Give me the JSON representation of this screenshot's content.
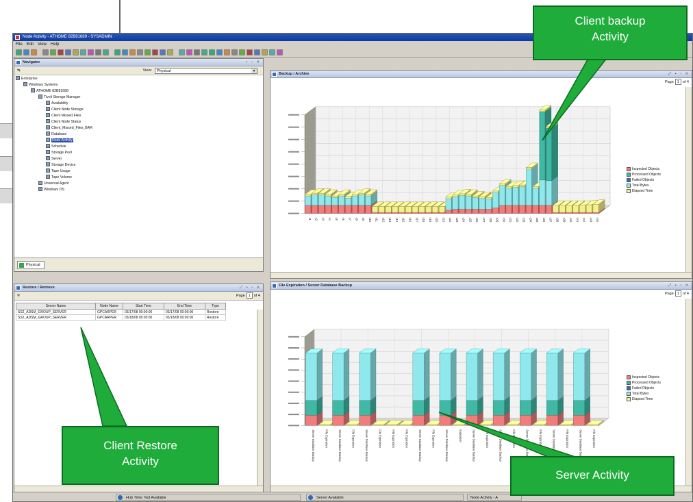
{
  "window": {
    "title": "Node Activity - ATHOME 82B81689 - SYSADMIN",
    "menus": [
      "File",
      "Edit",
      "View",
      "Help"
    ]
  },
  "navigator": {
    "title": "Navigator",
    "view_label": "View:",
    "view_value": "Physical",
    "tree": [
      {
        "label": "Enterprise",
        "level": 0
      },
      {
        "label": "Windows Systems",
        "level": 1
      },
      {
        "label": "ATHOME 82B81689",
        "level": 2
      },
      {
        "label": "Tivoli Storage Manager",
        "level": 3
      },
      {
        "label": "Availability",
        "level": 4
      },
      {
        "label": "Client Node Storage",
        "level": 4
      },
      {
        "label": "Client Missed Files",
        "level": 4
      },
      {
        "label": "Client Node Status",
        "level": 4
      },
      {
        "label": "Client_Missed_Files_BAR",
        "level": 4
      },
      {
        "label": "Database",
        "level": 4
      },
      {
        "label": "Node Activity",
        "level": 4,
        "selected": true
      },
      {
        "label": "Schedule",
        "level": 4
      },
      {
        "label": "Storage Pool",
        "level": 4
      },
      {
        "label": "Server",
        "level": 4
      },
      {
        "label": "Storage Device",
        "level": 4
      },
      {
        "label": "Tape Usage",
        "level": 4
      },
      {
        "label": "Tape Volume",
        "level": 4
      },
      {
        "label": "Universal Agent",
        "level": 3
      },
      {
        "label": "Windows OS",
        "level": 3
      }
    ],
    "tab_label": "Physical"
  },
  "restore": {
    "title": "Restore / Retrieve",
    "page_label": "Page",
    "page_value": "1",
    "page_total": "of 4",
    "columns": [
      "Server Name",
      "Node Name",
      "Start Time",
      "End Time",
      "Type"
    ],
    "rows": [
      [
        "SS2_ADSM_GROUP_SERVER",
        "GPCARPER",
        "03/17/08 00:00:00",
        "03/17/08 00:00:00",
        "Restore"
      ],
      [
        "SS2_ADSM_GROUP_SERVER",
        "GPCARPER",
        "03/18/08 00:00:00",
        "03/18/08 00:00:00",
        "Restore"
      ]
    ]
  },
  "backup": {
    "title": "Backup / Archive",
    "page_label": "Page",
    "page_value": "1",
    "page_total": "of 4"
  },
  "expiration": {
    "title": "File Expiration / Server Database Backup",
    "page_label": "Page",
    "page_value": "1",
    "page_total": "of 4"
  },
  "legend_labels": [
    "Inspected Objects",
    "Processed Objects",
    "Failed Objects",
    "Total Bytes",
    "Elapsed Time"
  ],
  "colors": {
    "inspected": "#f07c7c",
    "processed": "#3fb9a4",
    "failed": "#2f6fb5",
    "total_bytes": "#8ee8ec",
    "elapsed": "#f5f08a",
    "callout": "#1fac3b"
  },
  "chart_data": [
    {
      "type": "bar",
      "title": "Backup / Archive",
      "ylim": [
        0,
        1800000
      ],
      "categories": [
        "c1",
        "c2",
        "c3",
        "c4",
        "c5",
        "c6",
        "c7",
        "c8",
        "c9",
        "c10",
        "c11",
        "c12",
        "c13",
        "c14",
        "c15",
        "c16",
        "c17",
        "c18",
        "c19",
        "c20",
        "c21",
        "c22",
        "c23",
        "c24",
        "c25",
        "c26",
        "c27",
        "c28",
        "c29",
        "c30",
        "c31",
        "c32",
        "c33",
        "c34",
        "c35",
        "c36",
        "c37",
        "c38",
        "c39",
        "c40",
        "c41",
        "c42",
        "c43",
        "c44"
      ],
      "series": [
        {
          "name": "Inspected Objects",
          "values": [
            150000,
            150000,
            150000,
            150000,
            150000,
            150000,
            150000,
            150000,
            150000,
            150000,
            10000,
            10000,
            10000,
            10000,
            10000,
            10000,
            10000,
            10000,
            10000,
            10000,
            10000,
            60000,
            80000,
            80000,
            80000,
            80000,
            80000,
            80000,
            100000,
            150000,
            150000,
            150000,
            150000,
            150000,
            150000,
            150000,
            150000,
            10000,
            10000,
            10000,
            10000,
            10000,
            10000,
            10000
          ]
        },
        {
          "name": "Total Bytes",
          "values": [
            170000,
            190000,
            190000,
            170000,
            140000,
            170000,
            130000,
            170000,
            190000,
            170000,
            0,
            0,
            0,
            0,
            0,
            0,
            0,
            0,
            0,
            0,
            0,
            210000,
            230000,
            250000,
            240000,
            210000,
            200000,
            180000,
            280000,
            360000,
            310000,
            330000,
            340000,
            660000,
            310000,
            460000,
            450000,
            0,
            0,
            0,
            0,
            0,
            0,
            0
          ]
        },
        {
          "name": "Processed Objects",
          "values": [
            0,
            0,
            0,
            0,
            0,
            0,
            0,
            0,
            0,
            0,
            0,
            0,
            0,
            0,
            0,
            0,
            0,
            0,
            0,
            0,
            0,
            0,
            0,
            0,
            0,
            0,
            0,
            0,
            0,
            0,
            0,
            0,
            0,
            0,
            0,
            1250000,
            960000,
            0,
            0,
            0,
            0,
            0,
            0,
            0
          ]
        },
        {
          "name": "Elapsed Time",
          "values": [
            30000,
            30000,
            30000,
            30000,
            30000,
            30000,
            30000,
            30000,
            30000,
            30000,
            110000,
            110000,
            110000,
            110000,
            110000,
            110000,
            110000,
            110000,
            110000,
            110000,
            110000,
            30000,
            30000,
            30000,
            30000,
            30000,
            30000,
            30000,
            30000,
            30000,
            30000,
            30000,
            30000,
            30000,
            30000,
            30000,
            30000,
            130000,
            130000,
            130000,
            130000,
            130000,
            140000,
            150000
          ]
        }
      ]
    },
    {
      "type": "bar",
      "title": "File Expiration / Server Database Backup",
      "ylim": [
        0,
        6000000
      ],
      "categories": [
        "Server Database Backup",
        "File Expiration",
        "Server Database Backup",
        "File Expiration",
        "Server Database Backup",
        "File Expiration",
        "File Expiration",
        "File Expiration",
        "Server Database Backup",
        "File Expiration",
        "Server Database Backup",
        "Expiration",
        "Server Database Backup",
        "File Expiration",
        "Server Database Backup",
        "File Expiration",
        "Server Database Backup",
        "File Expiration",
        "Server Database Backup",
        "File Expiration",
        "Server Database Backup",
        "File Expiration"
      ],
      "series": [
        {
          "name": "Inspected Objects",
          "values": [
            700000,
            0,
            700000,
            0,
            700000,
            0,
            0,
            0,
            700000,
            0,
            700000,
            0,
            700000,
            0,
            700000,
            0,
            700000,
            0,
            700000,
            0,
            700000,
            0
          ]
        },
        {
          "name": "Processed Objects",
          "values": [
            1000000,
            0,
            1000000,
            0,
            1000000,
            0,
            0,
            0,
            1000000,
            0,
            1000000,
            0,
            1000000,
            0,
            1000000,
            0,
            1000000,
            0,
            1000000,
            0,
            1000000,
            0
          ]
        },
        {
          "name": "Total Bytes",
          "values": [
            3200000,
            0,
            3200000,
            0,
            3200000,
            0,
            0,
            0,
            3200000,
            0,
            3200000,
            0,
            3200000,
            0,
            3200000,
            0,
            3200000,
            0,
            3200000,
            0,
            3200000,
            0
          ]
        },
        {
          "name": "Elapsed Time",
          "values": [
            0,
            60000,
            0,
            60000,
            0,
            60000,
            60000,
            60000,
            0,
            60000,
            0,
            60000,
            0,
            60000,
            0,
            60000,
            0,
            60000,
            0,
            60000,
            0,
            60000
          ]
        }
      ]
    }
  ],
  "status": {
    "hub": "Hub Time: Not Available",
    "server": "Server Available",
    "node": "Node Activity - A"
  },
  "callouts": {
    "backup": "Client backup Activity",
    "restore": "Client Restore Activity",
    "server": "Server Activity"
  }
}
